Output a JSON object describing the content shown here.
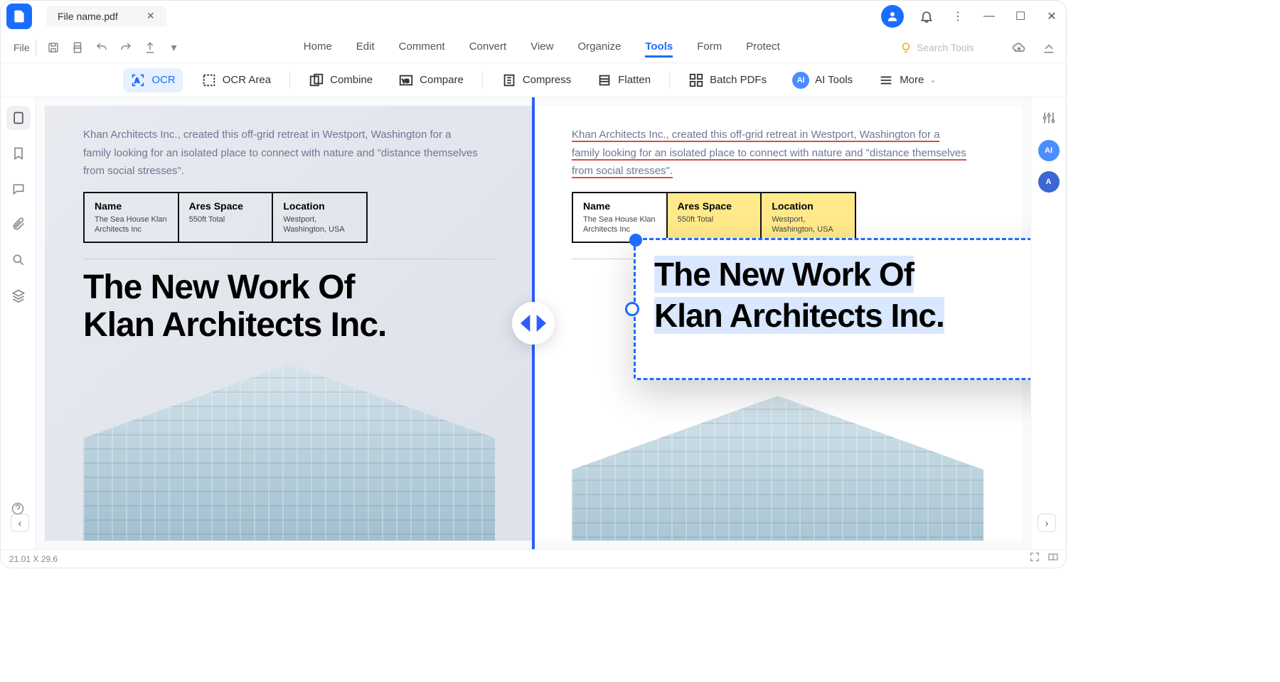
{
  "titlebar": {
    "filename": "File name.pdf"
  },
  "menubar": {
    "file": "File",
    "tabs": [
      "Home",
      "Edit",
      "Comment",
      "Convert",
      "View",
      "Organize",
      "Tools",
      "Form",
      "Protect"
    ],
    "active_tab": "Tools",
    "search_placeholder": "Search Tools"
  },
  "toolbar": {
    "ocr": "OCR",
    "ocr_area": "OCR Area",
    "combine": "Combine",
    "compare": "Compare",
    "compress": "Compress",
    "flatten": "Flatten",
    "batch": "Batch PDFs",
    "ai": "AI Tools",
    "ai_badge": "AI",
    "more": "More"
  },
  "doc": {
    "intro": "Khan Architects Inc., created this off-grid retreat in Westport, Washington for a family looking for an isolated place to connect with nature and \"distance themselves from social stresses\".",
    "table": {
      "h1": "Name",
      "v1": "The Sea House Klan Architects Inc",
      "h2": "Ares Space",
      "v2": "550ft Total",
      "h3": "Location",
      "v3a": "Westport,",
      "v3b": "Washington, USA"
    },
    "title_l1": "The New Work Of",
    "title_l2": "Klan Architects Inc."
  },
  "status": {
    "dims": "21.01 X 29.6"
  },
  "right_rail": {
    "ai": "AI",
    "az": "A"
  }
}
